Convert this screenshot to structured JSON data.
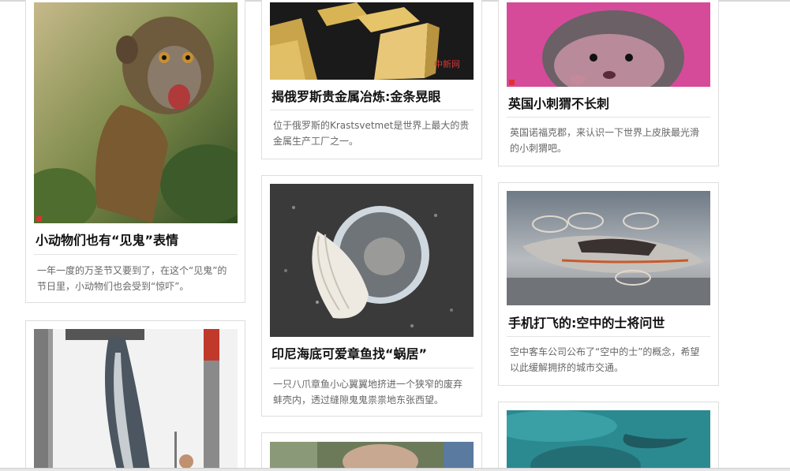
{
  "cards": [
    {
      "title": "小动物们也有“见鬼”表情",
      "desc": "一年一度的万圣节又要到了，在这个“见鬼”的节日里，小动物们也会受到“惊吓”。"
    },
    {
      "title": "揭俄罗斯贵金属冶炼:金条晃眼",
      "desc": "位于俄罗斯的Krastsvetmet是世界上最大的贵金属生产工厂之一。"
    },
    {
      "title": "英国小刺猬不长刺",
      "desc": "英国诺福克郡，来认识一下世界上皮肤最光滑的小刺猬吧。"
    },
    {
      "title": "印尼海底可爱章鱼找“蜗居”",
      "desc": "一只八爪章鱼小心翼翼地挤进一个狭窄的废弃蚌壳内，透过缝隙鬼鬼祟祟地东张西望。"
    },
    {
      "title": "手机打飞的:空中的士将问世",
      "desc": "空中客车公司公布了“空中的士”的概念，希望以此缓解拥挤的城市交通。"
    }
  ]
}
